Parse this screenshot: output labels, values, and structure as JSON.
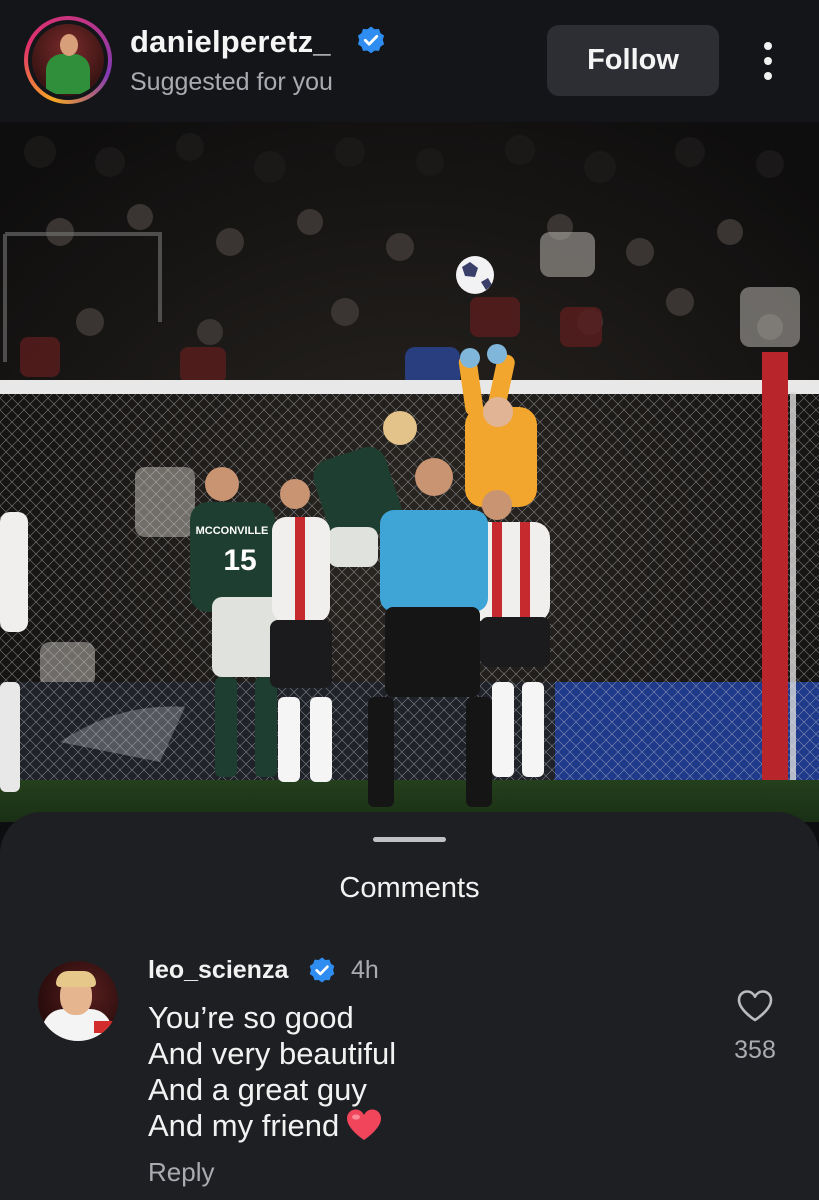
{
  "post": {
    "username": "danielperetz_",
    "subtitle": "Suggested for you",
    "follow_label": "Follow",
    "photo": {
      "shirt_name": "MCCONVILLE",
      "shirt_number": "15"
    }
  },
  "comments": {
    "title": "Comments",
    "items": [
      {
        "username": "leo_scienza",
        "time": "4h",
        "lines": [
          "You’re so good",
          "And very beautiful",
          "And a great guy",
          "And my friend"
        ],
        "emoji": "red-heart",
        "likes": "358",
        "reply_label": "Reply"
      }
    ]
  },
  "icons": {
    "verified": "verified-badge-icon",
    "more": "more-vertical-icon",
    "like": "heart-outline-icon"
  },
  "colors": {
    "background": "#0d0e10",
    "sheet": "#1e1f23",
    "verified": "#2f8cf0",
    "follow_button": "#2c2e33",
    "secondary_text": "#a9abb0",
    "heart_emoji": "#f0455a"
  }
}
